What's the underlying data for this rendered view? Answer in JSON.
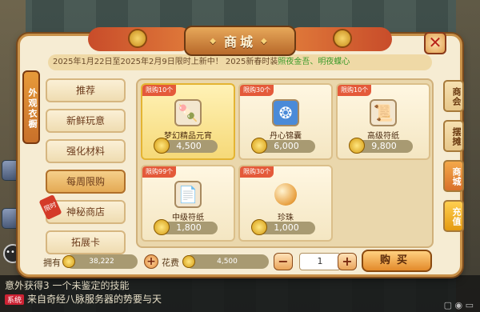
{
  "title": "商城",
  "announcement": {
    "prefix": "2025年1月22日至2025年2月9日限时上新中！    2025新春时装",
    "highlight": "照夜金吾、明夜蝶心"
  },
  "left_vertical_tab": "外观衣橱",
  "menu": [
    {
      "label": "推荐"
    },
    {
      "label": "新鲜玩意"
    },
    {
      "label": "强化材料"
    },
    {
      "label": "每周限购",
      "active": true
    },
    {
      "label": "神秘商店",
      "badge": "限时"
    },
    {
      "label": "拓展卡"
    }
  ],
  "items": [
    {
      "limit": "限购10个",
      "name": "梦幻精品元宵",
      "price": "4,500",
      "icon": "dumpling-icon",
      "selected": true
    },
    {
      "limit": "限购30个",
      "name": "丹心锦囊",
      "price": "6,000",
      "icon": "pouch-icon"
    },
    {
      "limit": "限购10个",
      "name": "高级符纸",
      "price": "9,800",
      "icon": "talisman-icon"
    },
    {
      "limit": "限购99个",
      "name": "中级符纸",
      "price": "1,800",
      "icon": "paper-icon"
    },
    {
      "limit": "限购30个",
      "name": "珍珠",
      "price": "1,000",
      "icon": "pearl-icon"
    }
  ],
  "right_tabs": [
    {
      "label": "商会"
    },
    {
      "label": "摆摊"
    },
    {
      "label": "商城",
      "active": true
    },
    {
      "label": "充值"
    }
  ],
  "bottom": {
    "owned_label": "拥有",
    "owned_value": "38,222",
    "cost_label": "花费",
    "cost_value": "4,500",
    "quantity": "1",
    "minus": "−",
    "plus": "+",
    "buy_label": "购买"
  },
  "chat": {
    "line1": "意外获得3 一个未鉴定的技能",
    "line2_tag": "系统",
    "line2": "来自奇经八脉服务器的势要与天"
  },
  "colors": {
    "accent": "#e38a2a",
    "limit_tag": "#e45a3a",
    "announce_green": "#3a9a2a"
  }
}
